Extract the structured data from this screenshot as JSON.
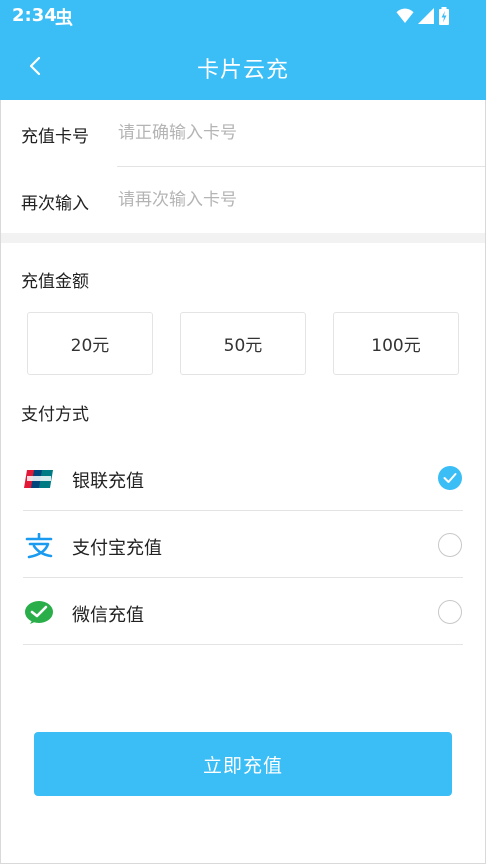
{
  "status_bar": {
    "time": "2:34",
    "notification_glyph": "虫"
  },
  "app_bar": {
    "title": "卡片云充"
  },
  "card_form": {
    "card_number": {
      "label": "充值卡号",
      "value": "",
      "placeholder": "请正确输入卡号"
    },
    "confirm_number": {
      "label": "再次输入",
      "value": "",
      "placeholder": "请再次输入卡号"
    }
  },
  "amount_section": {
    "title": "充值金额",
    "options": [
      "20元",
      "50元",
      "100元"
    ]
  },
  "payment_section": {
    "title": "支付方式",
    "methods": [
      {
        "label": "银联充值",
        "icon": "unionpay-icon",
        "selected": true
      },
      {
        "label": "支付宝充值",
        "icon": "alipay-icon",
        "selected": false
      },
      {
        "label": "微信充值",
        "icon": "wechat-icon",
        "selected": false
      }
    ]
  },
  "submit": {
    "label": "立即充值"
  },
  "colors": {
    "accent": "#3bbdf6",
    "divider": "#e4e4e4",
    "placeholder": "#b4b4b4"
  }
}
